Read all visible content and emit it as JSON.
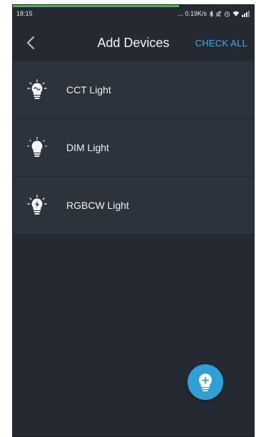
{
  "status_bar": {
    "time": "18:15",
    "network_speed": "... 0.19K/s"
  },
  "page_load_progress": 0.69,
  "header": {
    "title": "Add Devices",
    "check_all_label": "CHECK ALL"
  },
  "devices": [
    {
      "label": "CCT Light",
      "icon": "bulb-cct-icon"
    },
    {
      "label": "DIM Light",
      "icon": "bulb-dim-icon"
    },
    {
      "label": "RGBCW Light",
      "icon": "bulb-rgbcw-icon"
    }
  ],
  "colors": {
    "background": "#252a32",
    "list_item": "#2d333c",
    "accent": "#4aa8d8",
    "fab": "#2f9fd8",
    "progress": "#36c63a"
  },
  "fab": {
    "icon": "add-bulb-icon"
  }
}
